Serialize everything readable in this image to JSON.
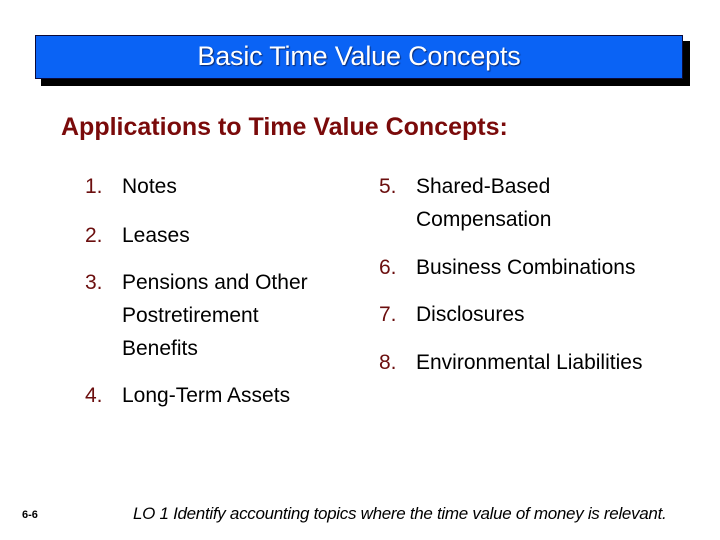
{
  "slide": {
    "title": "Basic Time Value Concepts",
    "heading": "Applications to Time Value Concepts:",
    "colors": {
      "title_bar": "#0A63F5",
      "title_text": "#FFFFFF",
      "heading": "#7A0A0A",
      "list_number": "#6B0E0E",
      "body_text": "#000000"
    },
    "list_left": [
      {
        "number": "1.",
        "text": "Notes"
      },
      {
        "number": "2.",
        "text": "Leases"
      },
      {
        "number": "3.",
        "text": "Pensions and Other\nPostretirement\nBenefits"
      },
      {
        "number": "4.",
        "text": "Long-Term Assets"
      }
    ],
    "list_right": [
      {
        "number": "5.",
        "text": "Shared-Based\nCompensation"
      },
      {
        "number": "6.",
        "text": "Business Combinations"
      },
      {
        "number": "7.",
        "text": "Disclosures"
      },
      {
        "number": "8.",
        "text": "Environmental Liabilities"
      }
    ],
    "footer": {
      "slide_number": "6-6",
      "learning_objective": "LO 1  Identify accounting topics where the time value of money is relevant."
    }
  }
}
